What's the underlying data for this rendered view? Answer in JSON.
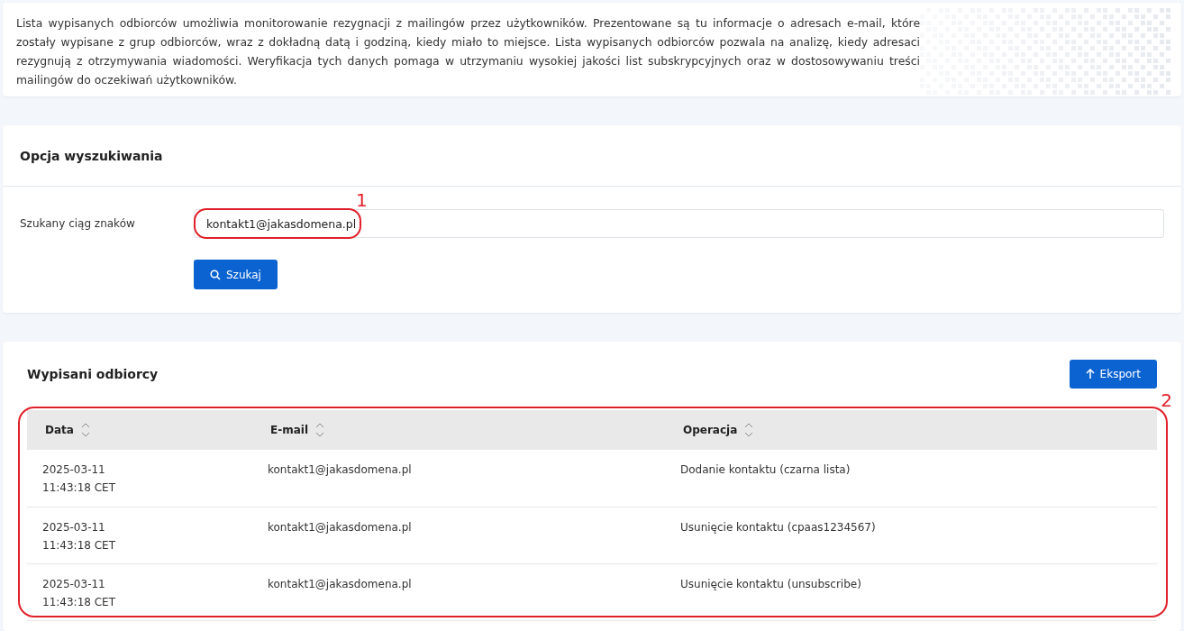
{
  "intro": {
    "text": "Lista wypisanych odbiorców umożliwia monitorowanie rezygnacji z mailingów przez użytkowników. Prezentowane są tu informacje o adresach e-mail, które zostały wypisane z grup odbiorców, wraz z dokładną datą i godziną, kiedy miało to miejsce. Lista wypisanych odbiorców pozwala na analizę, kiedy adresaci rezygnują z otrzymywania wiadomości. Weryfikacja tych danych pomaga w utrzymaniu wysokiej jakości list subskrypcyjnych oraz w dostosowywaniu treści mailingów do oczekiwań użytkowników."
  },
  "search": {
    "title": "Opcja wyszukiwania",
    "label": "Szukany ciąg znaków",
    "value": "kontakt1@jakasdomena.pl",
    "button": "Szukaj",
    "callout": "1"
  },
  "results": {
    "title": "Wypisani odbiorcy",
    "export_button": "Eksport",
    "callout": "2",
    "columns": [
      "Data",
      "E-mail",
      "Operacja"
    ],
    "rows": [
      {
        "date": "2025-03-11 11:43:18 CET",
        "email": "kontakt1@jakasdomena.pl",
        "operation": "Dodanie kontaktu (czarna lista)"
      },
      {
        "date": "2025-03-11 11:43:18 CET",
        "email": "kontakt1@jakasdomena.pl",
        "operation": "Usunięcie kontaktu (cpaas1234567)"
      },
      {
        "date": "2025-03-11 11:43:18 CET",
        "email": "kontakt1@jakasdomena.pl",
        "operation": "Usunięcie kontaktu (unsubscribe)"
      }
    ]
  }
}
